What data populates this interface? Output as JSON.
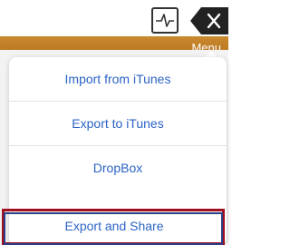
{
  "menu_bar": {
    "label": "Menu",
    "color": "#c1811f"
  },
  "toolbar": {
    "graph_icon": "waveform-graph-icon",
    "close_icon": "close-x-icon"
  },
  "menu": {
    "items": [
      {
        "label": "Import from iTunes"
      },
      {
        "label": "Export to iTunes"
      },
      {
        "label": "DropBox"
      },
      {
        "label": "Export and Share"
      }
    ],
    "text_color": "#2b63c6",
    "highlight_color": "#a01020"
  }
}
